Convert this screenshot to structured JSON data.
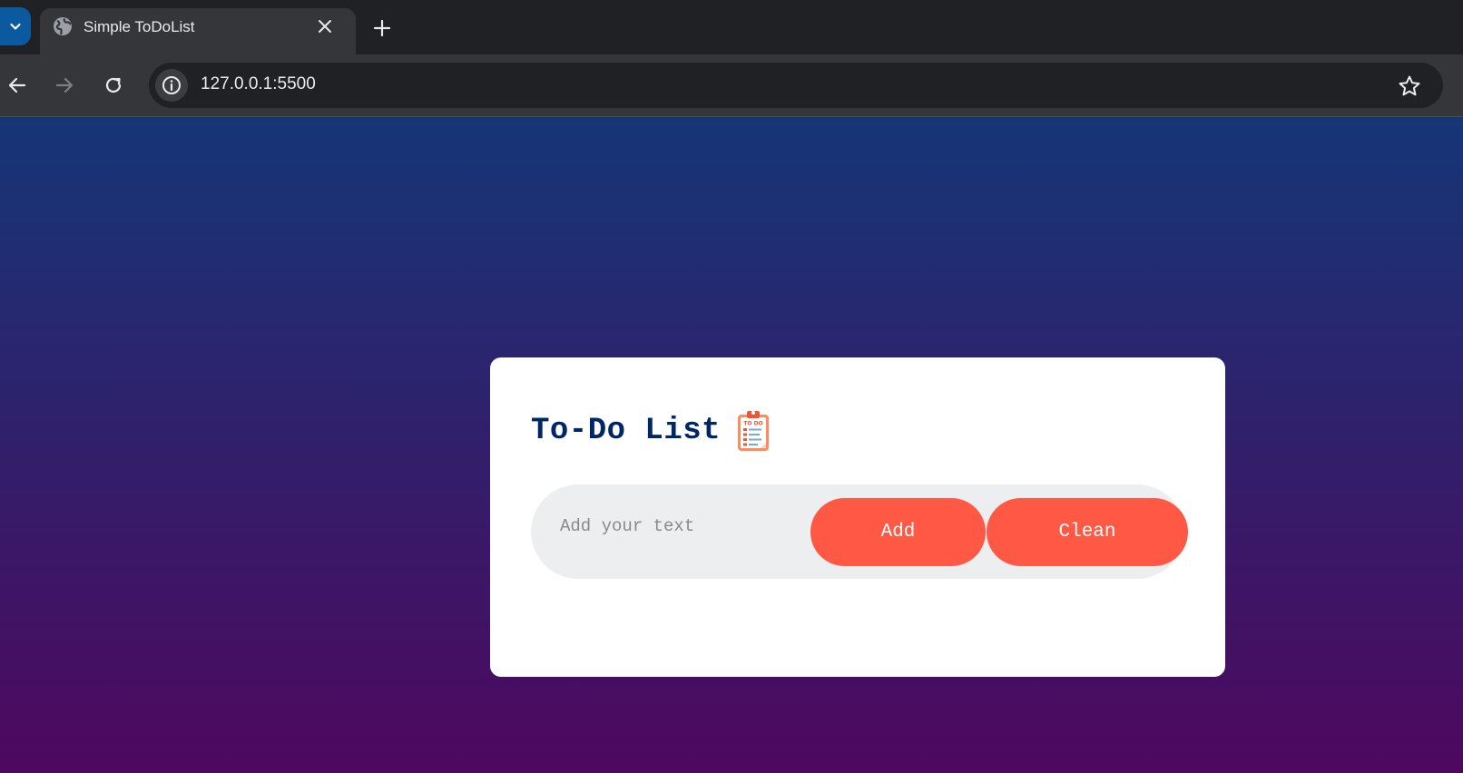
{
  "browser": {
    "tab": {
      "title": "Simple ToDoList"
    },
    "url": "127.0.0.1:5500",
    "colors": {
      "tab_menu": "#0b5aa0",
      "tabstrip": "#202124",
      "toolbar": "#35363a"
    }
  },
  "page": {
    "background_gradient": [
      "#153677",
      "#4e085f"
    ],
    "card": {
      "title": "To-Do List",
      "title_color": "#002765",
      "icon": "todo-clipboard-icon",
      "input": {
        "placeholder": "Add your text",
        "value": ""
      },
      "add_label": "Add",
      "clean_label": "Clean",
      "button_color": "#ff5945"
    }
  }
}
